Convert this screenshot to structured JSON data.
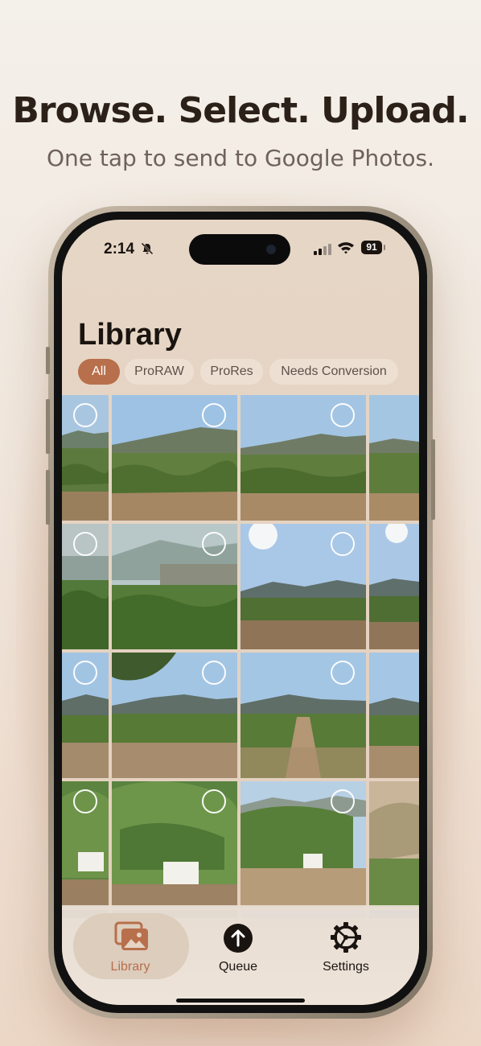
{
  "headline": "Browse. Select. Upload.",
  "subheadline": "One tap to send to Google Photos.",
  "status_bar": {
    "time": "2:14",
    "battery": "91",
    "silent_icon": "bell-slash-icon",
    "signal_icon": "cellular-signal-icon",
    "wifi_icon": "wifi-icon"
  },
  "screen": {
    "title": "Library",
    "filters": [
      {
        "label": "All",
        "selected": true
      },
      {
        "label": "ProRAW",
        "selected": false
      },
      {
        "label": "ProRes",
        "selected": false
      },
      {
        "label": "Needs Conversion",
        "selected": false
      }
    ],
    "photos": [
      {
        "scene": "vineyard-mountains",
        "selected": false
      },
      {
        "scene": "vineyard-mountains",
        "selected": false
      },
      {
        "scene": "vineyard-mountains",
        "selected": false
      },
      {
        "scene": "vineyard-mountains",
        "selected": false
      },
      {
        "scene": "vineyard-sign-hazy",
        "selected": false
      },
      {
        "scene": "vineyard-sign-hazy",
        "selected": false
      },
      {
        "scene": "vineyard-sun",
        "selected": false
      },
      {
        "scene": "vineyard-sun",
        "selected": false
      },
      {
        "scene": "vineyard-rows",
        "selected": false
      },
      {
        "scene": "vineyard-rows",
        "selected": false
      },
      {
        "scene": "vineyard-rows",
        "selected": false
      },
      {
        "scene": "vineyard-rows",
        "selected": false
      },
      {
        "scene": "vine-closeup-tag",
        "selected": false
      },
      {
        "scene": "vine-closeup-tag",
        "selected": false
      },
      {
        "scene": "vine-closeup-tag",
        "selected": false
      },
      {
        "scene": "dry-hillside",
        "selected": false
      }
    ]
  },
  "tabs": [
    {
      "label": "Library",
      "icon": "photo-library-icon",
      "active": true
    },
    {
      "label": "Queue",
      "icon": "upload-arrow-icon",
      "active": false
    },
    {
      "label": "Settings",
      "icon": "gear-icon",
      "active": false
    }
  ],
  "colors": {
    "accent": "#b86f4b",
    "text": "#1a1410",
    "chip_bg": "#ede0d3"
  }
}
